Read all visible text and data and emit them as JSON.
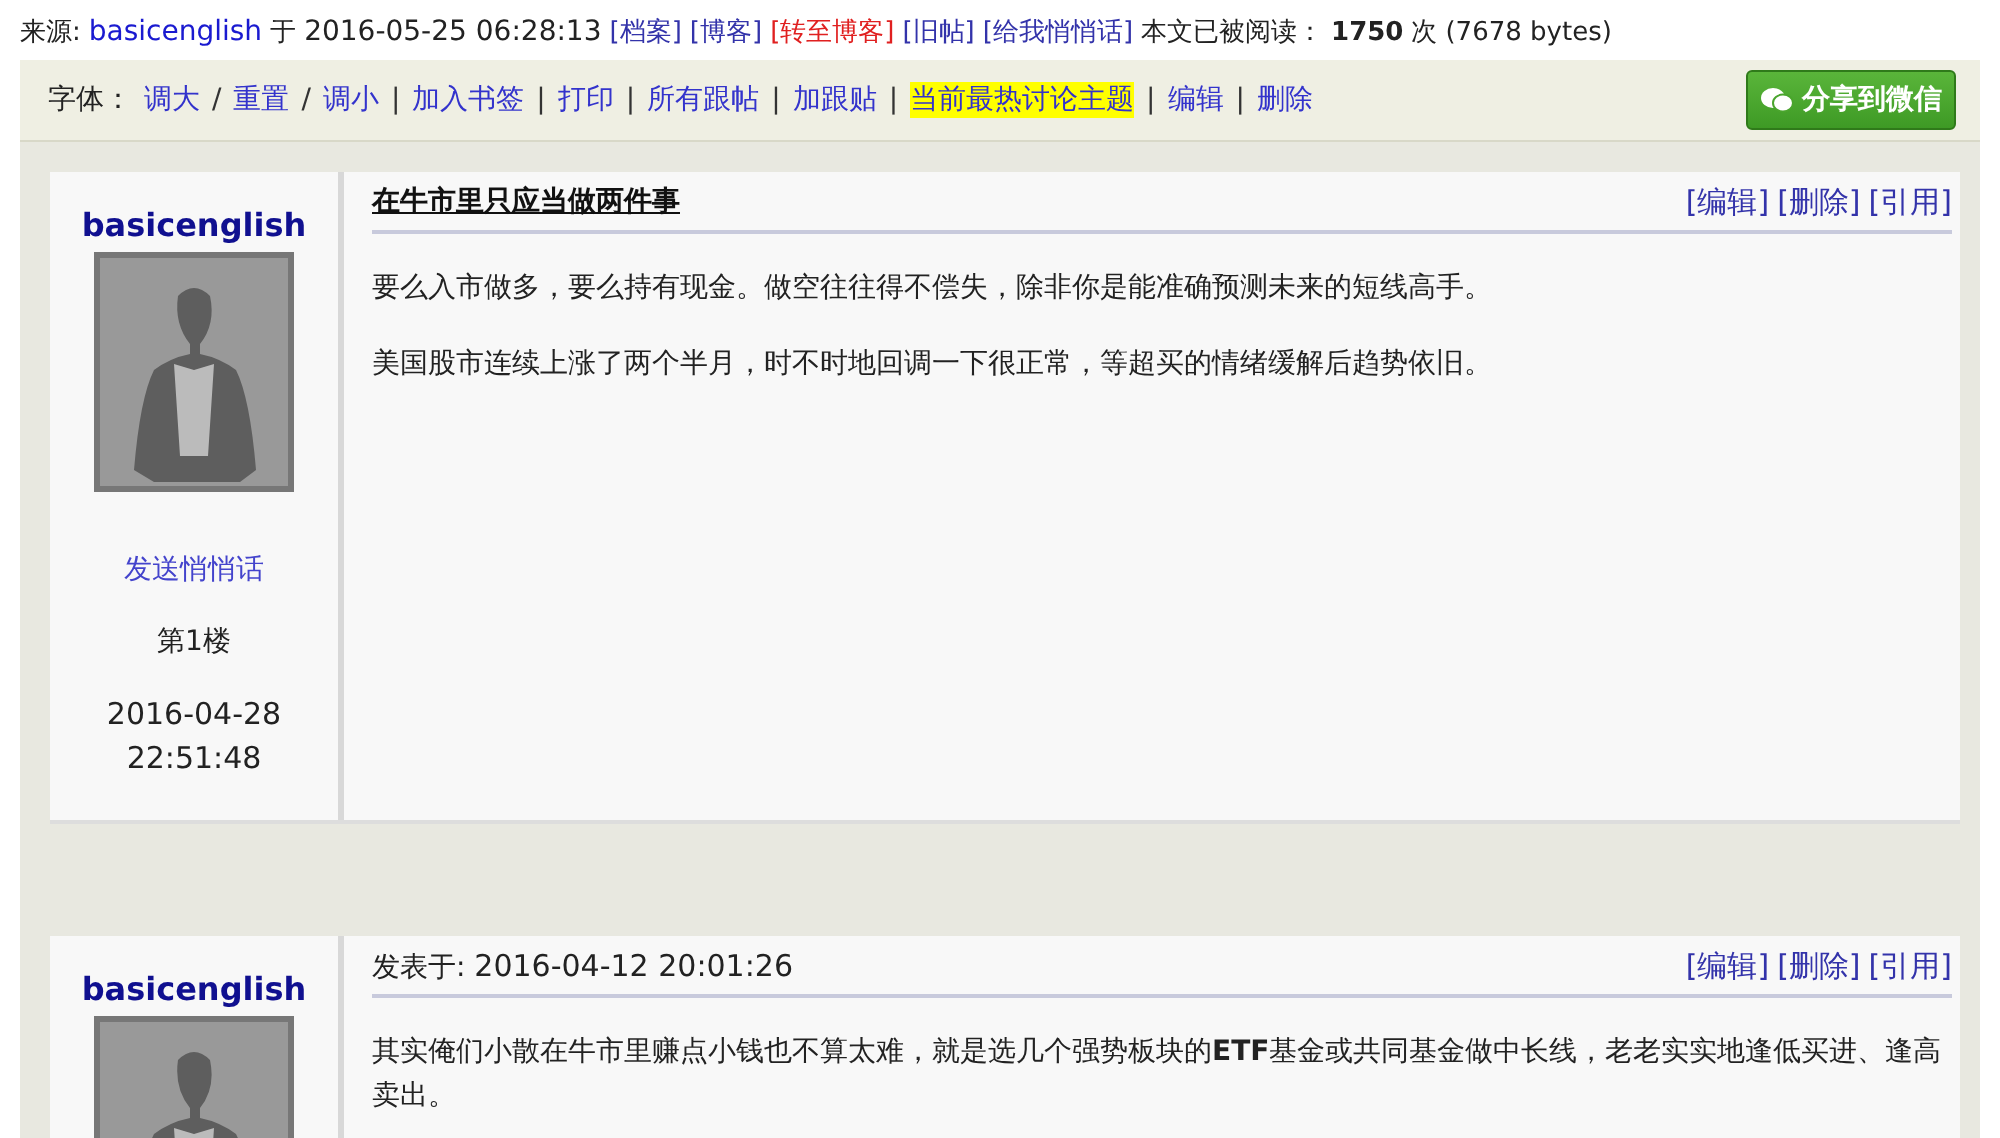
{
  "header": {
    "source_label": "来源:",
    "author": "basicenglish",
    "at": "于",
    "datetime": "2016-05-25 06:28:13",
    "links": [
      {
        "label": "[档案]",
        "kind": "normal"
      },
      {
        "label": "[博客]",
        "kind": "normal"
      },
      {
        "label": "[转至博客]",
        "kind": "red"
      },
      {
        "label": "[旧帖]",
        "kind": "normal"
      },
      {
        "label": "[给我悄悄话]",
        "kind": "normal"
      }
    ],
    "read_label": "本文已被阅读：",
    "read_count": "1750",
    "read_unit": "次",
    "bytes": "(7678 bytes)"
  },
  "toolbar": {
    "items": [
      {
        "kind": "label",
        "text": "字体："
      },
      {
        "kind": "link",
        "text": "调大",
        "highlighted": false
      },
      {
        "kind": "sep",
        "text": "/"
      },
      {
        "kind": "link",
        "text": "重置",
        "highlighted": false
      },
      {
        "kind": "sep",
        "text": "/"
      },
      {
        "kind": "link",
        "text": "调小",
        "highlighted": false
      },
      {
        "kind": "sep",
        "text": "|"
      },
      {
        "kind": "link",
        "text": "加入书签",
        "highlighted": false
      },
      {
        "kind": "sep",
        "text": "|"
      },
      {
        "kind": "link",
        "text": "打印",
        "highlighted": false
      },
      {
        "kind": "sep",
        "text": "|"
      },
      {
        "kind": "link",
        "text": "所有跟帖",
        "highlighted": false
      },
      {
        "kind": "sep",
        "text": "|"
      },
      {
        "kind": "link",
        "text": "加跟贴",
        "highlighted": false
      },
      {
        "kind": "sep",
        "text": "|"
      },
      {
        "kind": "link",
        "text": "当前最热讨论主题",
        "highlighted": true
      },
      {
        "kind": "sep",
        "text": "|"
      },
      {
        "kind": "link",
        "text": "编辑",
        "highlighted": false
      },
      {
        "kind": "sep",
        "text": "|"
      },
      {
        "kind": "link",
        "text": "删除",
        "highlighted": false
      }
    ],
    "share_button": "分享到微信"
  },
  "posts": [
    {
      "author": "basicenglish",
      "whisper": "发送悄悄话",
      "floor": "第1楼",
      "date": "2016-04-28",
      "time": "22:51:48",
      "heading": {
        "kind": "title",
        "text": "在牛市里只应当做两件事"
      },
      "actions": [
        "[编辑]",
        "[删除]",
        "[引用]"
      ],
      "paragraphs": [
        "要么入市做多，要么持有现金。做空往往得不偿失，除非你是能准确预测未来的短线高手。",
        "美国股市连续上涨了两个半月，时不时地回调一下很正常，等超买的情绪缓解后趋势依旧。"
      ]
    },
    {
      "author": "basicenglish",
      "heading": {
        "kind": "posted",
        "label": "发表于:",
        "text": "2016-04-12 20:01:26"
      },
      "actions": [
        "[编辑]",
        "[删除]",
        "[引用]"
      ],
      "paragraphs": [
        "其实俺们小散在牛市里赚点小钱也不算太难，就是选几个强势板块的**ETF**基金或共同基金做中长线，老老实实地逢低买进、逢高卖出。"
      ]
    }
  ]
}
